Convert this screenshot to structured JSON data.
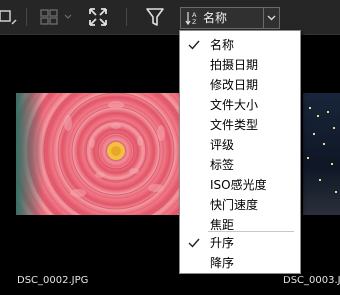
{
  "toolbar": {
    "sort_button": {
      "label": "名称"
    }
  },
  "sort_menu": {
    "fields": [
      {
        "label": "名称",
        "checked": true
      },
      {
        "label": "拍摄日期",
        "checked": false
      },
      {
        "label": "修改日期",
        "checked": false
      },
      {
        "label": "文件大小",
        "checked": false
      },
      {
        "label": "文件类型",
        "checked": false
      },
      {
        "label": "评级",
        "checked": false
      },
      {
        "label": "标签",
        "checked": false
      },
      {
        "label": "ISO感光度",
        "checked": false
      },
      {
        "label": "快门速度",
        "checked": false
      },
      {
        "label": "焦距",
        "checked": false
      }
    ],
    "orders": [
      {
        "label": "升序",
        "checked": true
      },
      {
        "label": "降序",
        "checked": false
      }
    ]
  },
  "thumbnails": [
    {
      "filename": "DSC_0002.JPG"
    },
    {
      "filename": "DSC_0003.J"
    }
  ],
  "colors": {
    "toolbar_bg": "#262626",
    "menu_bg": "#ffffff",
    "page_bg": "#000000"
  }
}
